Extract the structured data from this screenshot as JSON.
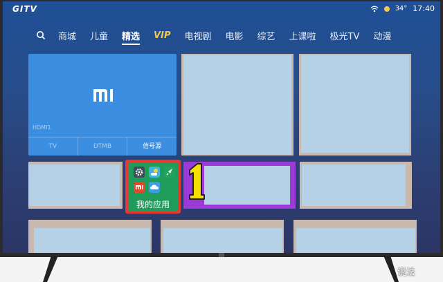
{
  "header": {
    "logo": "GITV",
    "temperature": "34°",
    "time": "17:40"
  },
  "nav": {
    "items": [
      {
        "label": "商城"
      },
      {
        "label": "儿童"
      },
      {
        "label": "精选",
        "active": true
      },
      {
        "label": "VIP"
      },
      {
        "label": "电视剧"
      },
      {
        "label": "电影"
      },
      {
        "label": "综艺"
      },
      {
        "label": "上课啦"
      },
      {
        "label": "极光TV"
      },
      {
        "label": "动漫"
      }
    ]
  },
  "mi_tile": {
    "logo": "MI",
    "input": "HDMI1",
    "sources": [
      "TV",
      "DTMB",
      "信号源"
    ]
  },
  "apps_tile": {
    "label": "我的应用",
    "icons": [
      "settings-icon",
      "weather-icon",
      "rocket-icon",
      "mi-icon",
      "cloud-icon"
    ]
  },
  "annotation": {
    "number": "1"
  },
  "watermark": "说法",
  "colors": {
    "screen_bg": "#27498a",
    "mi_tile": "#3b8ee0",
    "apps_tile_border": "#e43a33",
    "apps_tile_bg": "#1f9c5a",
    "focus_purple": "#9b3ad6",
    "annotation_yellow": "#f5e000",
    "vip": "#f2c94c"
  }
}
